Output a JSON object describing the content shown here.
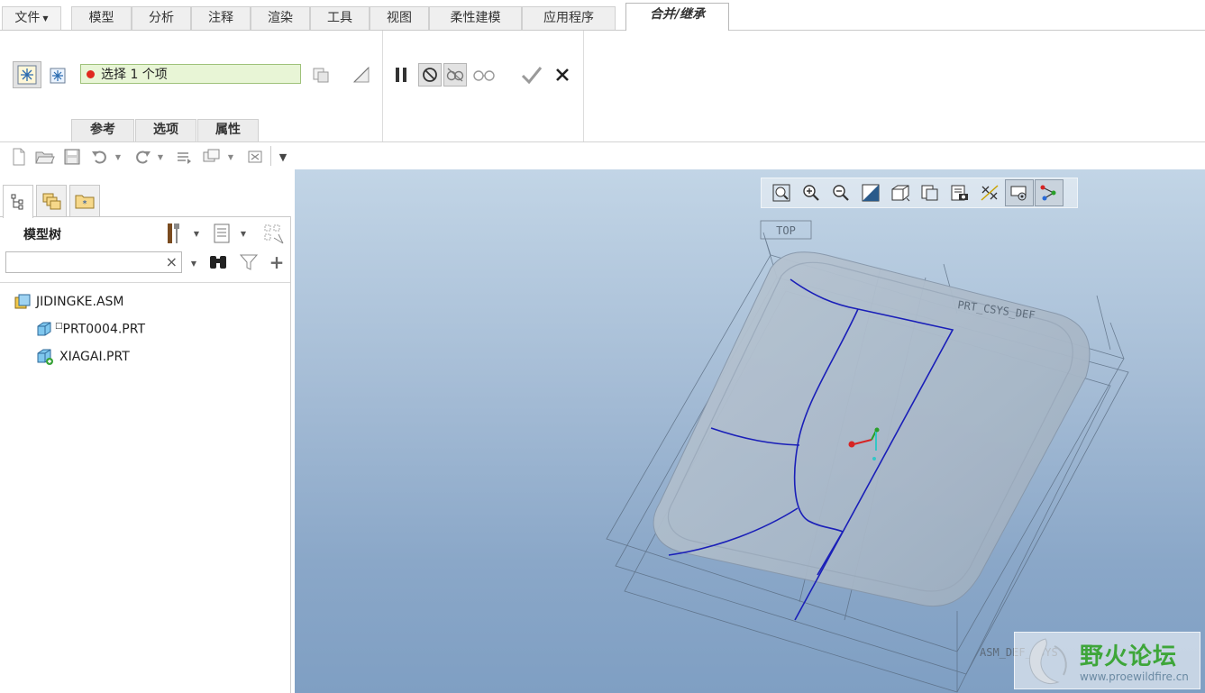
{
  "ribbon_tabs": [
    "文件",
    "模型",
    "分析",
    "注释",
    "渲染",
    "工具",
    "视图",
    "柔性建模",
    "应用程序",
    "合并/继承"
  ],
  "collector": {
    "text": "选择 1 个项"
  },
  "sub_tabs": [
    "参考",
    "选项",
    "属性"
  ],
  "navigator": {
    "tree_title": "模型树",
    "search_placeholder": "",
    "items": [
      "JIDINGKE.ASM",
      "PRT0004.PRT",
      "XIAGAI.PRT"
    ]
  },
  "viewport": {
    "view_labels": {
      "top": "TOP",
      "prt_csys": "PRT_CSYS_DEF",
      "asm_csys": "ASM_DEF_CSYS"
    }
  },
  "watermark": {
    "title": "野火论坛",
    "url": "www.proewildfire.cn"
  },
  "colors": {
    "collector_bg": "#e8f5d6",
    "curve_blue": "#1a1fb8",
    "viewport_top": "#c2d5e6",
    "viewport_bottom": "#7f9fc3",
    "watermark_green": "#3ea63a"
  },
  "icons": {
    "ribbon": [
      "select-ref-icon",
      "select-ref-small-icon",
      "copy-icon",
      "plane-icon",
      "pause-icon",
      "no-preview-icon",
      "preview-icon",
      "glasses-icon",
      "ok-check-icon",
      "cancel-x-icon"
    ],
    "qat": [
      "new-icon",
      "open-icon",
      "save-icon",
      "undo-icon",
      "redo-icon",
      "regenerate-icon",
      "windows-icon",
      "close-window-icon",
      "customize-icon"
    ],
    "view_toolbar": [
      "refit-icon",
      "zoom-in-icon",
      "zoom-out-icon",
      "repaint-icon",
      "display-style-icon",
      "saved-views-icon",
      "view-manager-icon",
      "datum-display-icon",
      "spin-center-icon",
      "annotation-icon"
    ]
  }
}
